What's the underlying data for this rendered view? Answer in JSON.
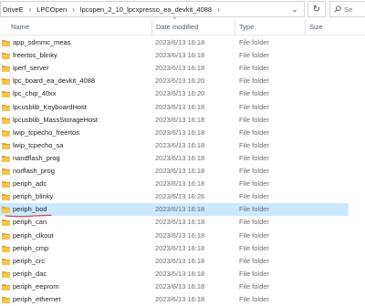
{
  "breadcrumb": [
    "DriveE",
    "LPCOpen",
    "lpcopen_2_10_lpcxpresso_ea_devkit_4088"
  ],
  "address_icons": {
    "dropdown": "chevron-down-icon",
    "refresh": "refresh-icon",
    "search": "search-icon"
  },
  "search": {
    "placeholder": "Se"
  },
  "columns": {
    "name": "Name",
    "date": "Date modified",
    "type": "Type",
    "size": "Size"
  },
  "files": [
    {
      "name": "app_sdmmc_meas",
      "date": "2023/6/13 16:18",
      "type": "File folder"
    },
    {
      "name": "freertos_blinky",
      "date": "2023/6/13 16:18",
      "type": "File folder"
    },
    {
      "name": "iperf_server",
      "date": "2023/6/13 16:18",
      "type": "File folder"
    },
    {
      "name": "lpc_board_ea_devkit_4088",
      "date": "2023/6/13 16:20",
      "type": "File folder"
    },
    {
      "name": "lpc_chip_40xx",
      "date": "2023/6/13 16:20",
      "type": "File folder"
    },
    {
      "name": "lpcusblib_KeyboardHost",
      "date": "2023/6/13 16:18",
      "type": "File folder"
    },
    {
      "name": "lpcusblib_MassStorageHost",
      "date": "2023/6/13 16:18",
      "type": "File folder"
    },
    {
      "name": "lwip_tcpecho_freertos",
      "date": "2023/6/13 16:18",
      "type": "File folder"
    },
    {
      "name": "lwip_tcpecho_sa",
      "date": "2023/6/13 16:18",
      "type": "File folder"
    },
    {
      "name": "nandflash_prog",
      "date": "2023/6/13 16:18",
      "type": "File folder"
    },
    {
      "name": "norflash_prog",
      "date": "2023/6/13 16:18",
      "type": "File folder"
    },
    {
      "name": "periph_adc",
      "date": "2023/6/13 16:18",
      "type": "File folder"
    },
    {
      "name": "periph_blinky",
      "date": "2023/6/13 16:26",
      "type": "File folder"
    },
    {
      "name": "periph_bod",
      "date": "2023/6/13 16:18",
      "type": "File folder"
    },
    {
      "name": "periph_can",
      "date": "2023/6/13 16:18",
      "type": "File folder"
    },
    {
      "name": "periph_clkout",
      "date": "2023/6/13 16:18",
      "type": "File folder"
    },
    {
      "name": "periph_cmp",
      "date": "2023/6/13 16:18",
      "type": "File folder"
    },
    {
      "name": "periph_crc",
      "date": "2023/6/13 16:18",
      "type": "File folder"
    },
    {
      "name": "periph_dac",
      "date": "2023/6/13 16:18",
      "type": "File folder"
    },
    {
      "name": "periph_eeprom",
      "date": "2023/6/13 16:18",
      "type": "File folder"
    },
    {
      "name": "periph_ethernet",
      "date": "2023/6/13 16:18",
      "type": "File folder"
    }
  ],
  "selected_index": 13,
  "annotation_index": 13,
  "colors": {
    "folder": "#f4c44f",
    "folder_dark": "#dca63a",
    "selection": "#cce8ff",
    "annotation": "#e0424f"
  }
}
